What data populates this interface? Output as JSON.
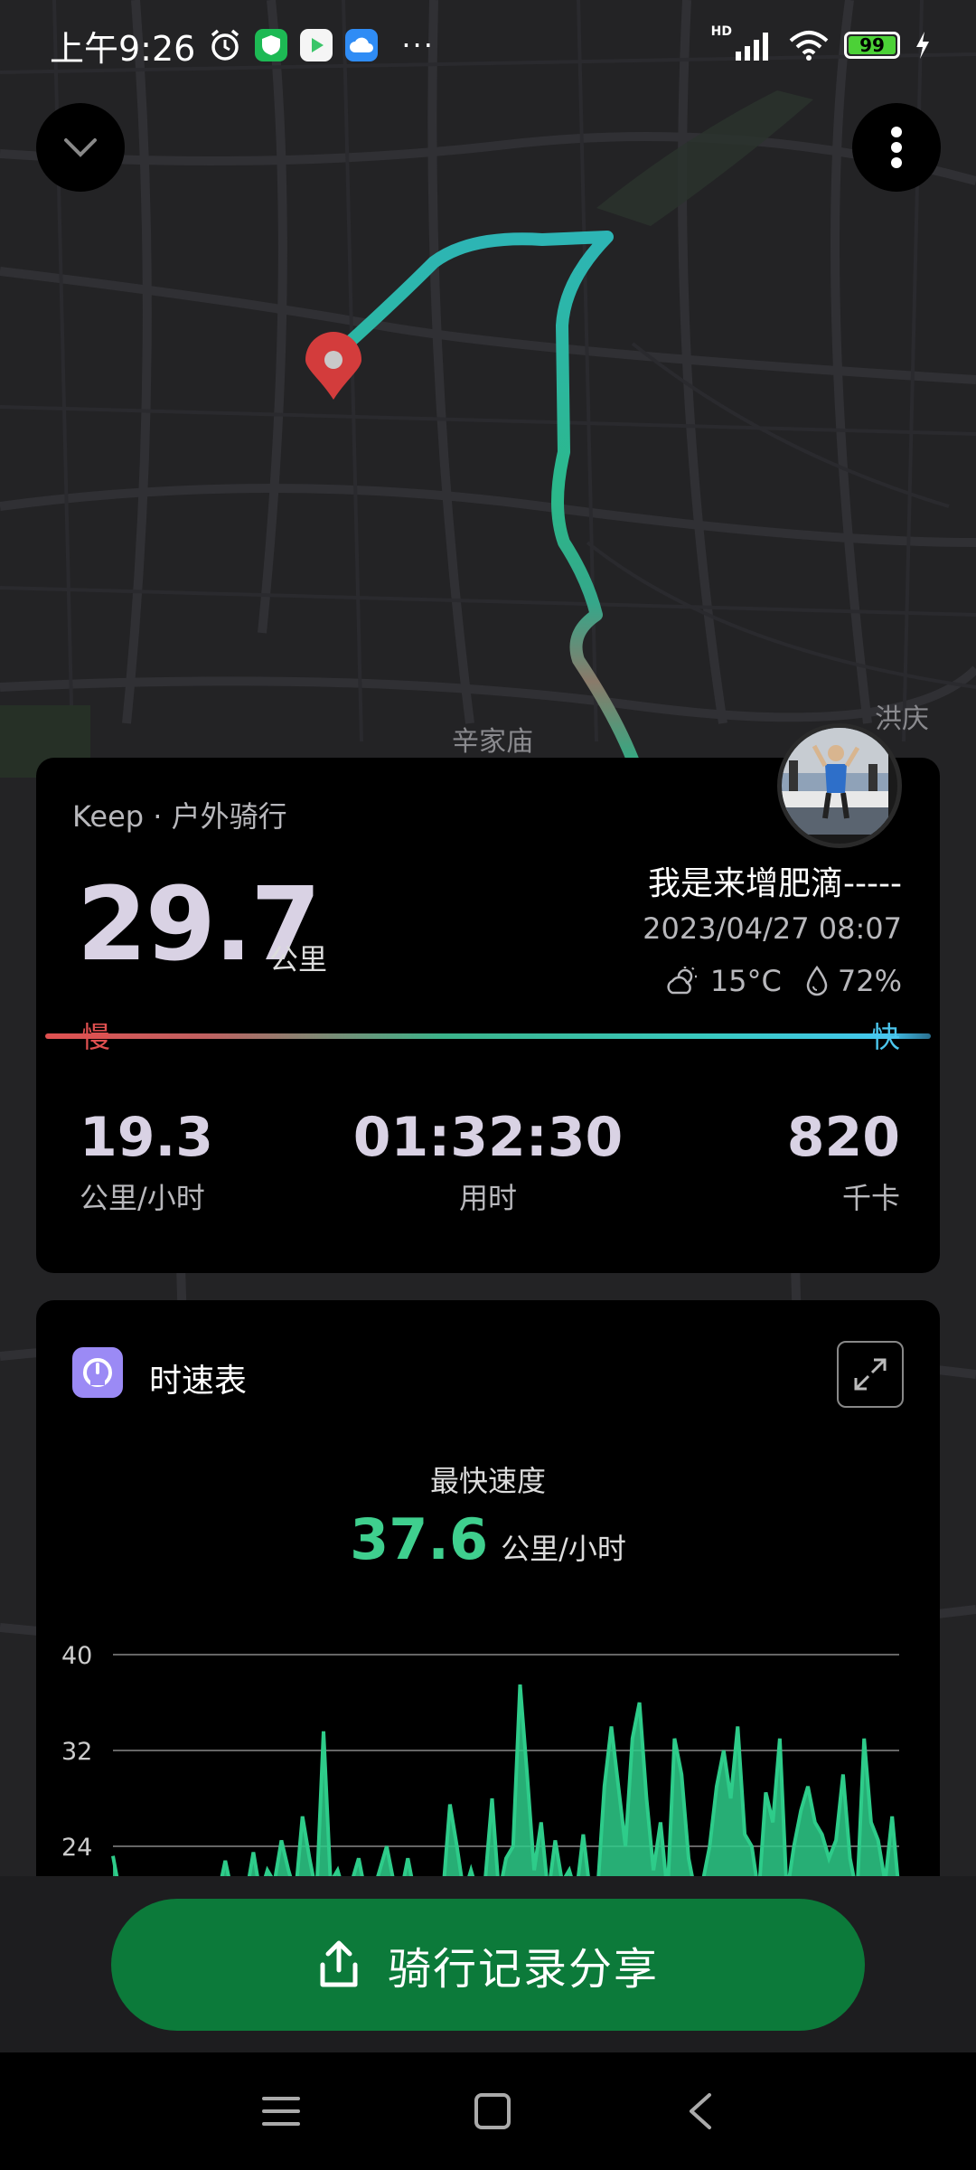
{
  "status_bar": {
    "time": "上午9:26",
    "network": "HD",
    "battery": "99"
  },
  "map": {
    "labels": [
      "辛家庙",
      "洪庆"
    ]
  },
  "summary_card": {
    "source": "Keep · 户外骑行",
    "distance": "29.7",
    "distance_unit": "公里",
    "username": "我是来增肥滴-----",
    "datetime": "2023/04/27 08:07",
    "temperature": "15°C",
    "humidity": "72%",
    "slow_label": "慢",
    "fast_label": "快",
    "avg_speed": "19.3",
    "avg_speed_label": "公里/小时",
    "duration": "01:32:30",
    "duration_label": "用时",
    "calories": "820",
    "calories_label": "千卡"
  },
  "speed_card": {
    "title": "时速表",
    "max_speed_label": "最快速度",
    "max_speed": "37.6",
    "max_speed_unit": "公里/小时"
  },
  "chart_data": {
    "type": "area",
    "title": "",
    "xlabel": "",
    "ylabel": "",
    "y_ticks": [
      40,
      32,
      24
    ],
    "ylim": [
      20,
      40
    ],
    "grid": true,
    "color": "#2ecc8a",
    "values": [
      23.2,
      20,
      20,
      20,
      20,
      20,
      20,
      20,
      20,
      20,
      20,
      20,
      20,
      20,
      20,
      20,
      22.8,
      20,
      20,
      20,
      23.5,
      20,
      22,
      21,
      24.5,
      22,
      20,
      26.5,
      23,
      20,
      33.6,
      21,
      22,
      20,
      21,
      23,
      20,
      20,
      22,
      24,
      21,
      20,
      23,
      20,
      20,
      21,
      20,
      20,
      27.5,
      24,
      20,
      22,
      20,
      21,
      28,
      20,
      23,
      24,
      37.5,
      30,
      22,
      26,
      20,
      24.5,
      21,
      22,
      20,
      25,
      20,
      20,
      29,
      34,
      29,
      24,
      33,
      36,
      28,
      22,
      26,
      20,
      33,
      30,
      23,
      20,
      21,
      24,
      29,
      32,
      28,
      34,
      25,
      24,
      20,
      28.5,
      26,
      33,
      20,
      24,
      27,
      29,
      26,
      25,
      23,
      24.5,
      30,
      23,
      20,
      33,
      26,
      24.5,
      21,
      26.5,
      20
    ]
  },
  "share": {
    "label": "骑行记录分享"
  },
  "colors": {
    "accent": "#3fcf8e",
    "share_button": "#0c7a3a",
    "slow": "#e05050",
    "fast": "#4cc7ee"
  }
}
